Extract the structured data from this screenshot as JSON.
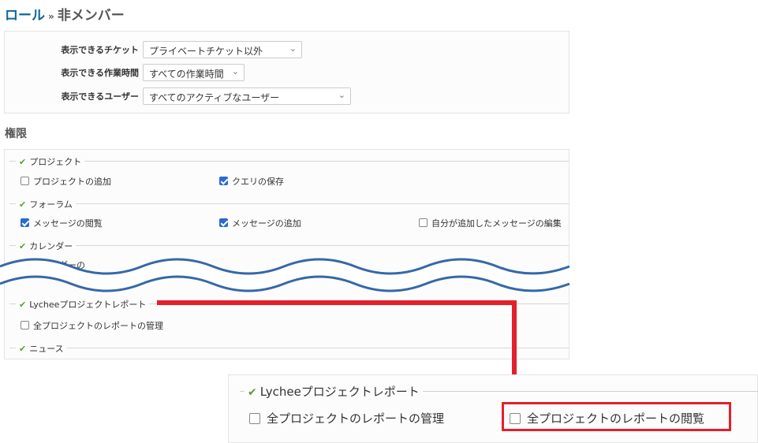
{
  "breadcrumb": {
    "parent": "ロール",
    "separator": "»",
    "current": "非メンバー"
  },
  "settings": {
    "visible_issues": {
      "label": "表示できるチケット",
      "value": "プライベートチケット以外"
    },
    "visible_time_entries": {
      "label": "表示できる作業時間",
      "value": "すべての作業時間"
    },
    "visible_users": {
      "label": "表示できるユーザー",
      "value": "すべてのアクティブなユーザー"
    }
  },
  "permissions_title": "権限",
  "groups": {
    "project": {
      "title": "プロジェクト",
      "items": [
        {
          "label": "プロジェクトの追加",
          "checked": false
        },
        {
          "label": "クエリの保存",
          "checked": true
        }
      ]
    },
    "forum": {
      "title": "フォーラム",
      "items": [
        {
          "label": "メッセージの閲覧",
          "checked": true
        },
        {
          "label": "メッセージの追加",
          "checked": true
        },
        {
          "label": "自分が追加したメッセージの編集",
          "checked": false
        }
      ]
    },
    "calendar": {
      "title": "カレンダー",
      "items": [
        {
          "label": "カレンダーの",
          "checked": true
        }
      ]
    },
    "lychee": {
      "title": "Lycheeプロジェクトレポート",
      "items": [
        {
          "label": "全プロジェクトのレポートの管理",
          "checked": false
        }
      ]
    },
    "news": {
      "title": "ニュース"
    }
  },
  "zoom": {
    "title": "Lycheeプロジェクトレポート",
    "items": [
      {
        "label": "全プロジェクトのレポートの管理",
        "checked": false
      },
      {
        "label": "全プロジェクトのレポートの閲覧",
        "checked": false
      }
    ]
  },
  "icons": {
    "group_check": "checkmark-icon",
    "select_arrow": "chevron-down-icon"
  },
  "colors": {
    "link": "#116699",
    "highlight": "#e3202a",
    "checkbox_on": "#2a6ad2",
    "wave": "#3568a8",
    "check_icon": "#5b9e3a"
  }
}
